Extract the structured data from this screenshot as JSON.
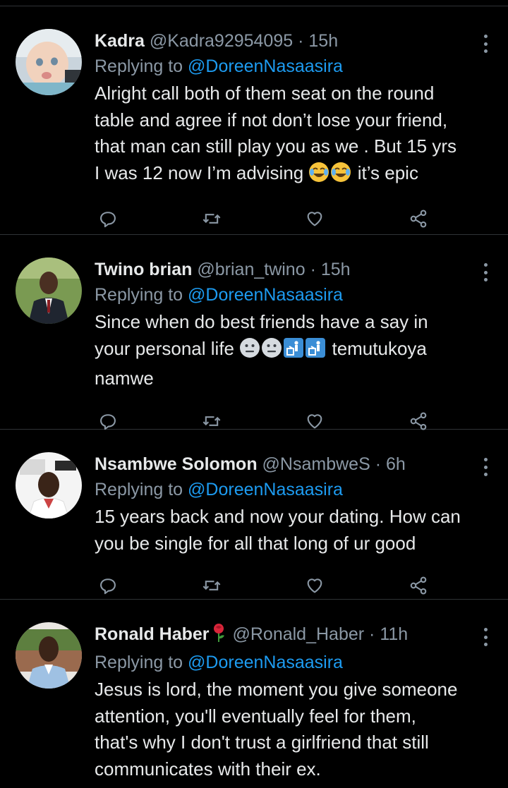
{
  "tweets": [
    {
      "name": "Kadra",
      "handle": "@Kadra92954095",
      "dot": "·",
      "time": "15h",
      "replying_prefix": "Replying to",
      "replying_to": "@DoreenNasaasira",
      "text_lines": [
        "Alright call both of them seat on the round",
        "table and agree if not don’t lose your friend,",
        "that man can still play you as we . But 15 yrs",
        "I was 12 now I’m advising",
        "it’s epic"
      ],
      "emojis": [
        "face-with-tears-of-joy",
        "face-with-tears-of-joy"
      ]
    },
    {
      "name": "Twino brian",
      "handle": "@brian_twino",
      "dot": "·",
      "time": "15h",
      "replying_prefix": "Replying to",
      "replying_to": "@DoreenNasaasira",
      "text_lines": [
        "Since when do best friends have a say in",
        "your personal life",
        "temutukoya",
        "namwe"
      ],
      "emojis": [
        "neutral-face",
        "neutral-face",
        "litter-in-bin-sign",
        "litter-in-bin-sign"
      ]
    },
    {
      "name": "Nsambwe Solomon",
      "handle": "@NsambweS",
      "dot": "·",
      "time": "6h",
      "replying_prefix": "Replying to",
      "replying_to": "@DoreenNasaasira",
      "text_lines": [
        "15 years back and now your dating. How can",
        "you be single for all that long of ur good"
      ]
    },
    {
      "name": "Ronald Haber",
      "name_emoji": "rose",
      "handle": "@Ronald_Haber",
      "dot": "·",
      "time": "11h",
      "replying_prefix": "Replying to",
      "replying_to": "@DoreenNasaasira",
      "text_lines": [
        "Jesus is lord, the moment you give someone",
        "attention, you'll eventually feel for them,",
        "that's why I don't trust a girlfriend that still",
        "communicates with their ex."
      ]
    }
  ],
  "icons": {
    "reply": "reply-icon",
    "retweet": "retweet-icon",
    "like": "like-icon",
    "share": "share-icon",
    "more": "more-icon"
  },
  "colors": {
    "background": "#000000",
    "text": "#e7e9ea",
    "secondary": "#8b98a5",
    "link": "#1d9bf0",
    "divider": "#2f3336"
  }
}
